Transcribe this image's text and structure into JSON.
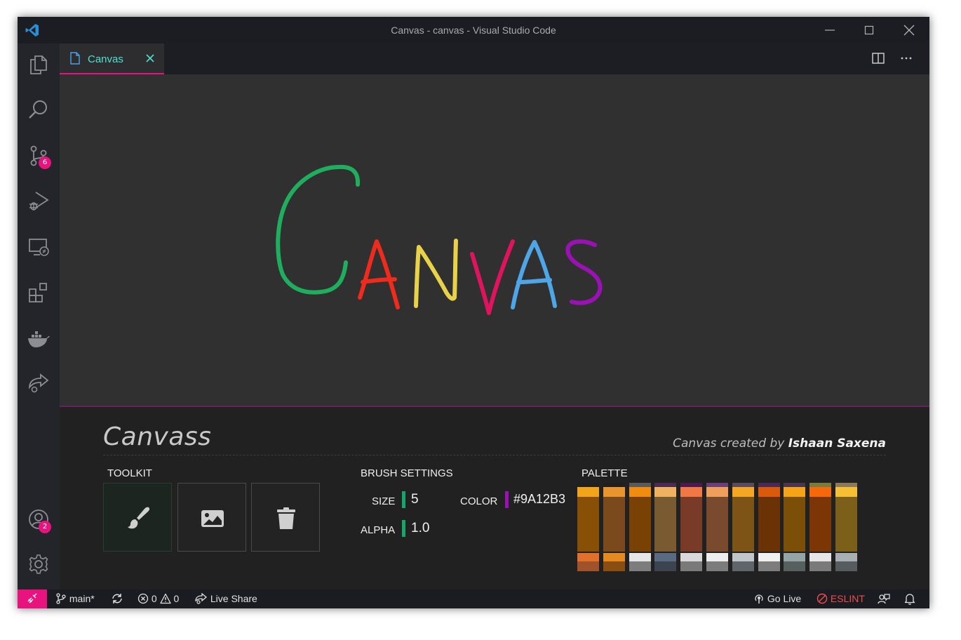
{
  "window": {
    "title": "Canvas - canvas - Visual Studio Code"
  },
  "activity_bar": {
    "items": [
      {
        "icon": "files-icon"
      },
      {
        "icon": "search-icon"
      },
      {
        "icon": "source-control-icon",
        "badge": "6"
      },
      {
        "icon": "run-debug-icon"
      },
      {
        "icon": "remote-explorer-icon"
      },
      {
        "icon": "extensions-icon"
      },
      {
        "icon": "docker-icon"
      },
      {
        "icon": "live-share-icon"
      }
    ],
    "bottom": [
      {
        "icon": "accounts-icon",
        "badge": "2"
      },
      {
        "icon": "settings-gear-icon"
      }
    ]
  },
  "tabs": [
    {
      "label": "Canvas",
      "active": true
    }
  ],
  "canvas": {
    "drawing_strokes": [
      {
        "letter": "C",
        "color": "#1fae5e"
      },
      {
        "letter": "A",
        "color": "#ee2b1c"
      },
      {
        "letter": "N",
        "color": "#e8d24a"
      },
      {
        "letter": "V",
        "color": "#e0135e"
      },
      {
        "letter": "A",
        "color": "#4ea6e6"
      },
      {
        "letter": "S",
        "color": "#9a12b3"
      }
    ]
  },
  "panel": {
    "brand": "Canvass",
    "credit_prefix": "Canvas created by",
    "credit_author": "Ishaan Saxena",
    "toolkit": {
      "title": "TOOLKIT",
      "tools": [
        {
          "name": "brush",
          "icon": "paintbrush-icon",
          "active": true
        },
        {
          "name": "image",
          "icon": "image-icon",
          "active": false
        },
        {
          "name": "clear",
          "icon": "trash-icon",
          "active": false
        }
      ]
    },
    "brush_settings": {
      "title": "BRUSH SETTINGS",
      "size_label": "SIZE",
      "size_value": "5",
      "alpha_label": "ALPHA",
      "alpha_value": "1.0",
      "color_label": "COLOR",
      "color_value": "#9A12B3",
      "accent_green": "#12a86b",
      "accent_purple": "#9a12b3"
    },
    "palette": {
      "title": "PALETTE",
      "columns": [
        {
          "top": "#1f1f1f",
          "head": "#f2a41a",
          "body": "#875006",
          "mid": "#e0702c",
          "low": "#a0522a"
        },
        {
          "top": "#1f1f1f",
          "head": "#e9952f",
          "body": "#7a4a1c",
          "mid": "#e58a20",
          "low": "#8a4d12"
        },
        {
          "top": "#5a5a5a",
          "head": "#f08c10",
          "body": "#7a4105",
          "mid": "#e6e6e6",
          "low": "#7d7d7d"
        },
        {
          "top": "#4a2a55",
          "head": "#efb260",
          "body": "#7a5a30",
          "mid": "#5a6a80",
          "low": "#3c4452"
        },
        {
          "top": "#4a1a50",
          "head": "#f07844",
          "body": "#7a3a28",
          "mid": "#d9d9d9",
          "low": "#7a7a7a"
        },
        {
          "top": "#6a3f78",
          "head": "#ef9e5c",
          "body": "#7a4a2e",
          "mid": "#ededed",
          "low": "#7c7c7c"
        },
        {
          "top": "#5a4a5e",
          "head": "#f5a623",
          "body": "#7d5316",
          "mid": "#bfc5c8",
          "low": "#606569"
        },
        {
          "top": "#4a2a55",
          "head": "#d85a0a",
          "body": "#6a3205",
          "mid": "#f0f0f0",
          "low": "#7d7d7d"
        },
        {
          "top": "#4a3450",
          "head": "#f5a418",
          "body": "#7c4f08",
          "mid": "#95a5a6",
          "low": "#55605f"
        },
        {
          "top": "#7a7a3a",
          "head": "#f6680c",
          "body": "#7c3606",
          "mid": "#e6e6e6",
          "low": "#7a7a7a"
        },
        {
          "top": "#8a7a5a",
          "head": "#f5c034",
          "body": "#7c601a",
          "mid": "#a9b0b3",
          "low": "#575d5f"
        }
      ]
    }
  },
  "status_bar": {
    "branch": "main*",
    "errors": "0",
    "warnings": "0",
    "live_share": "Live Share",
    "go_live": "Go Live",
    "eslint": "ESLINT"
  }
}
